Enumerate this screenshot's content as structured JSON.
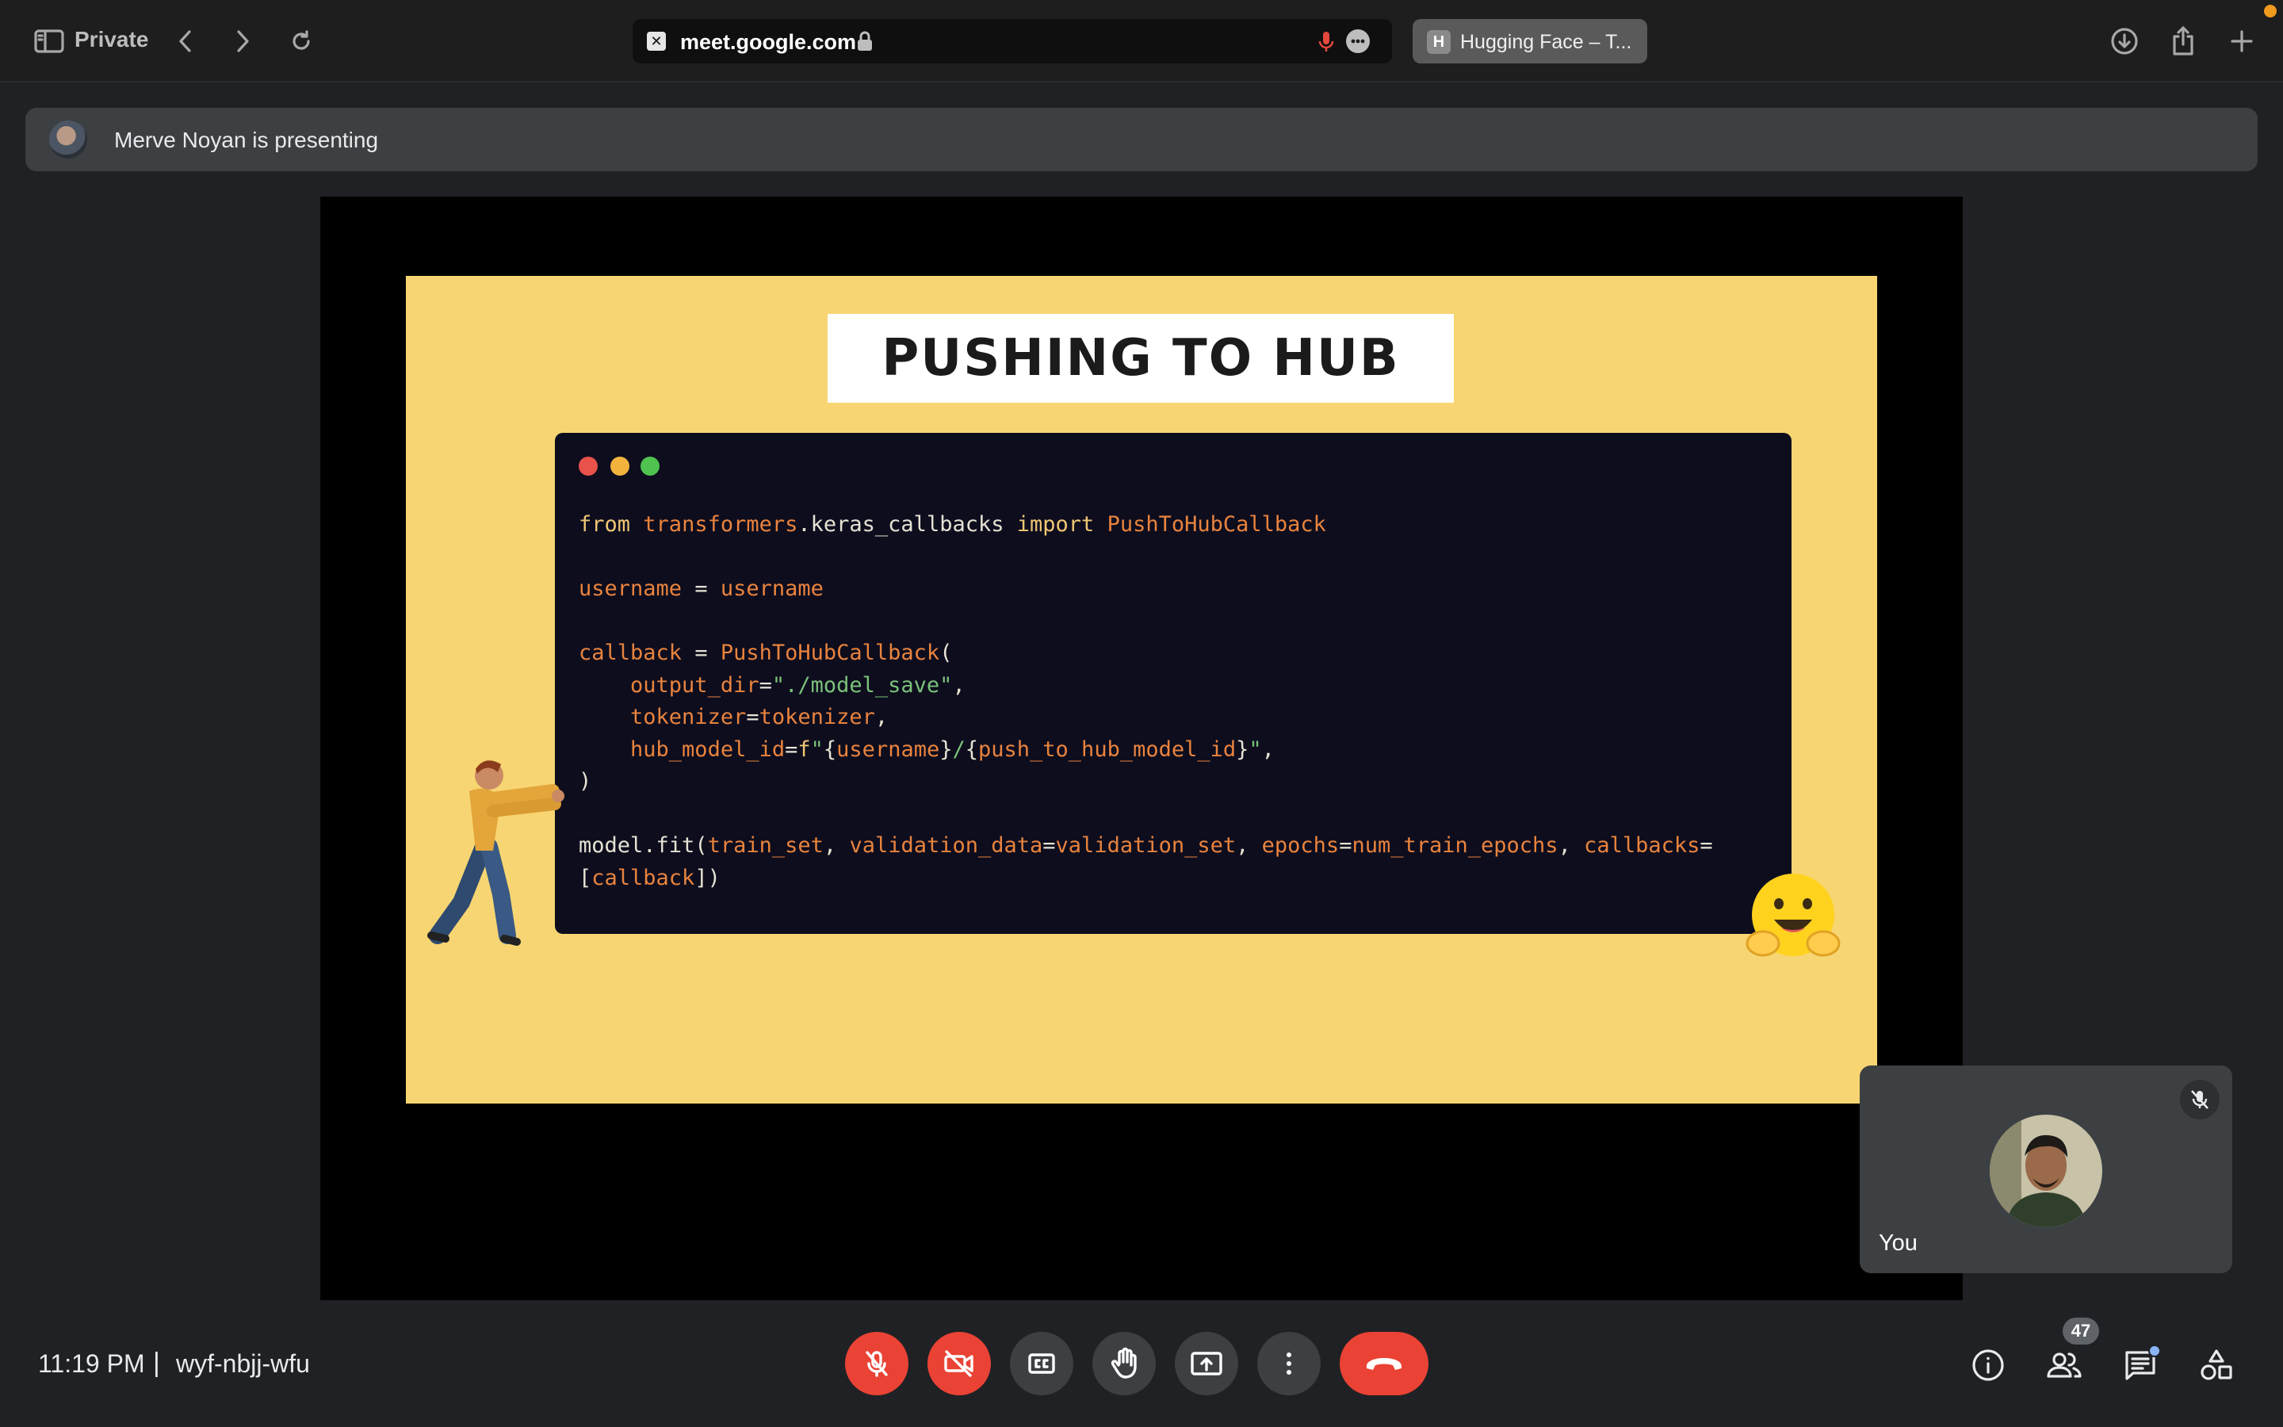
{
  "browser": {
    "private_label": "Private",
    "address": "meet.google.com",
    "tab_favicon_letter": "H",
    "tab_title": "Hugging Face – T..."
  },
  "banner": {
    "text": "Merve Noyan is presenting"
  },
  "slide": {
    "title": "PUSHING TO HUB",
    "code_lines": [
      "from transformers.keras_callbacks import PushToHubCallback",
      "",
      "username = username",
      "",
      "callback = PushToHubCallback(",
      "    output_dir=\"./model_save\",",
      "    tokenizer=tokenizer,",
      "    hub_model_id=f\"{username}/{push_to_hub_model_id}\",",
      ")",
      "",
      "model.fit(train_set, validation_data=validation_set, epochs=num_train_epochs, callbacks=",
      "[callback])"
    ]
  },
  "self_tile": {
    "name": "You"
  },
  "bottom_bar": {
    "time": "11:19 PM",
    "separator": "|",
    "meeting_code": "wyf-nbjj-wfu",
    "people_count": "47"
  },
  "colors": {
    "accent_red": "#ea4335",
    "control_gray": "#3c4043",
    "slide_yellow": "#f7d572",
    "code_bg": "#0d0d1e"
  },
  "icons": {
    "sidebar": "sidebar-icon",
    "back": "chevron-left-icon",
    "forward": "chevron-right-icon",
    "reload": "reload-icon",
    "lock": "lock-icon",
    "mic": "microphone-icon",
    "more": "ellipsis-icon",
    "download": "download-icon",
    "share": "share-icon",
    "new_tab": "plus-icon"
  }
}
